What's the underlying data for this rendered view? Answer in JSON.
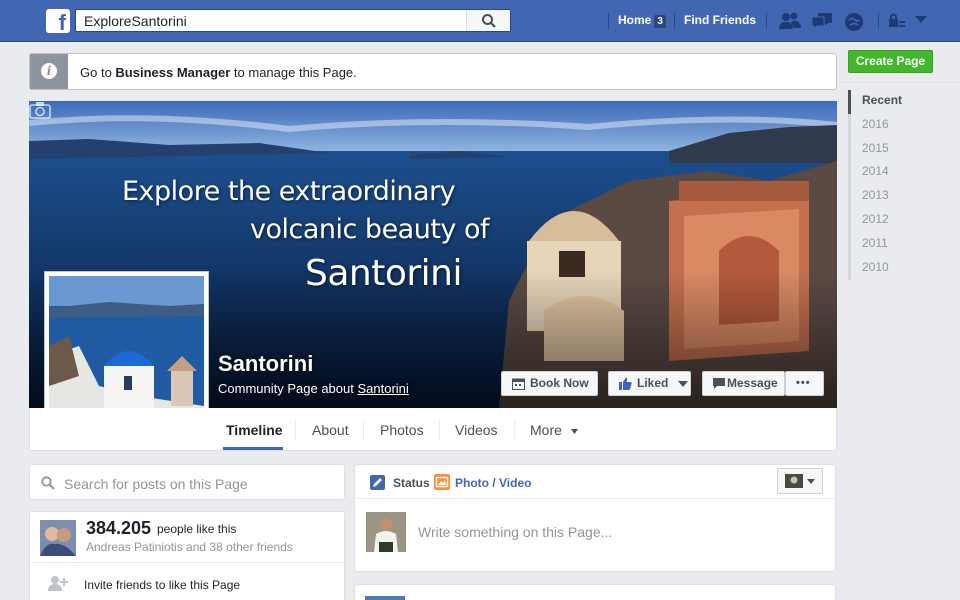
{
  "topbar": {
    "logo": "f",
    "search_value": "ExploreSantorini",
    "home_label": "Home",
    "home_count": "3",
    "find_friends_label": "Find Friends",
    "icons": [
      "friends-icon",
      "messages-icon",
      "notifications-icon",
      "privacy-icon",
      "account-menu-icon"
    ]
  },
  "notice": {
    "prefix": "Go to ",
    "link": "Business Manager",
    "suffix": " to manage this Page."
  },
  "cover": {
    "line1": "Explore the extraordinary",
    "line2": "volcanic beauty of",
    "line3": "Santorini"
  },
  "page": {
    "name": "Santorini",
    "subtitle_prefix": "Community Page about ",
    "subtitle_link": "Santorini"
  },
  "actions": {
    "book_now": "Book Now",
    "liked": "Liked",
    "message": "Message",
    "more": "•••"
  },
  "tabs": [
    {
      "label": "Timeline",
      "active": true
    },
    {
      "label": "About"
    },
    {
      "label": "Photos"
    },
    {
      "label": "Videos"
    },
    {
      "label": "More"
    }
  ],
  "sidebar": {
    "create_page": "Create Page",
    "years": [
      "Recent",
      "2016",
      "2015",
      "2014",
      "2013",
      "2012",
      "2011",
      "2010"
    ]
  },
  "left": {
    "search_placeholder": "Search for posts on this Page",
    "likes_count": "384.205",
    "likes_label": "people like this",
    "likes_friends": "Andreas Patiniotis and 38 other friends",
    "invite": "Invite friends to like this Page"
  },
  "composer": {
    "status": "Status",
    "photo_video": "Photo / Video",
    "placeholder": "Write something on this Page..."
  },
  "colors": {
    "brand_blue": "#4267b2",
    "create_green": "#42b72a"
  }
}
